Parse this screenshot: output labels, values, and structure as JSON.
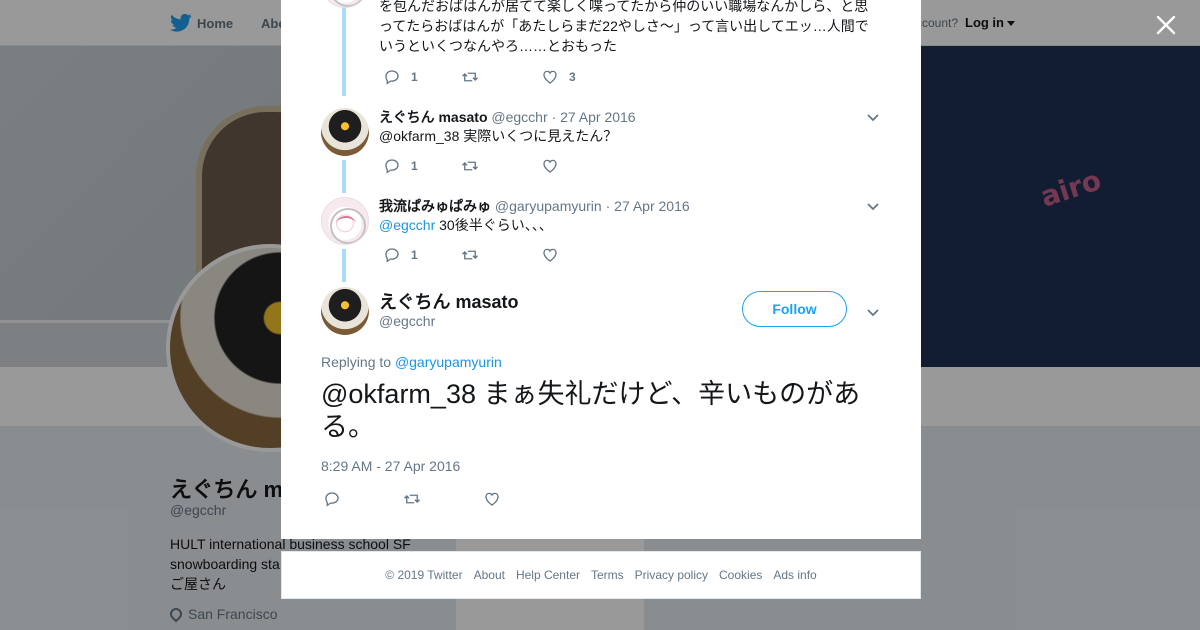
{
  "nav": {
    "home": "Home",
    "about": "Abo",
    "have_account": "ccount?",
    "login": "Log in"
  },
  "profile": {
    "name": "えぐちん m",
    "handle": "@egcchr",
    "bio_line1": "HULT international business school SF",
    "bio_line2": "snowboarding sta",
    "bio_line3": "ご屋さん",
    "location": "San Francisco"
  },
  "background_card": {
    "ads_text": "Ads info"
  },
  "thread": {
    "top_tweet": {
      "text_line1": "を包んだおばはんが居てて楽しく喋ってたから仲のいい職場なんかしら、と思",
      "text_line2": "ってたらおばはんが「あたしらまだ22やしさ〜」って言い出してエッ…人間で",
      "text_line3": "いうといくつなんやろ……とおもった",
      "replies": "1",
      "retweets": "",
      "likes": "3"
    },
    "tweets": [
      {
        "name": "えぐちん masato",
        "handle": "@egcchr",
        "dot": "·",
        "date": "27 Apr 2016",
        "mention": "",
        "text": "@okfarm_38 実際いくつに見えたん？",
        "replies": "1",
        "retweets": "",
        "likes": ""
      },
      {
        "name": "我流ぱみゅぱみゅ",
        "handle": "@garyupamyurin",
        "dot": "·",
        "date": "27 Apr 2016",
        "mention": "@egcchr",
        "text": " 30後半ぐらい、、、",
        "replies": "1",
        "retweets": "",
        "likes": ""
      }
    ],
    "main": {
      "name": "えぐちん masato",
      "handle": "@egcchr",
      "follow_label": "Follow",
      "replying_prefix": "Replying to ",
      "replying_to": "@garyupamyurin",
      "text": "@okfarm_38 まぁ失礼だけど、辛いものがある。",
      "timestamp": "8:29 AM - 27 Apr 2016"
    }
  },
  "footer": {
    "copyright": "© 2019 Twitter",
    "about": "About",
    "help": "Help Center",
    "terms": "Terms",
    "privacy": "Privacy policy",
    "cookies": "Cookies",
    "ads": "Ads info"
  },
  "colors": {
    "accent": "#1da1f2",
    "mention": "#1b95e0",
    "thread_line": "#a9dcf9",
    "muted_text": "#657786"
  },
  "icons": {
    "close": "close-icon",
    "reply": "reply-icon",
    "retweet": "retweet-icon",
    "like": "heart-icon",
    "caret": "chevron-down-icon",
    "bird": "twitter-bird-icon",
    "location": "location-pin-icon"
  }
}
